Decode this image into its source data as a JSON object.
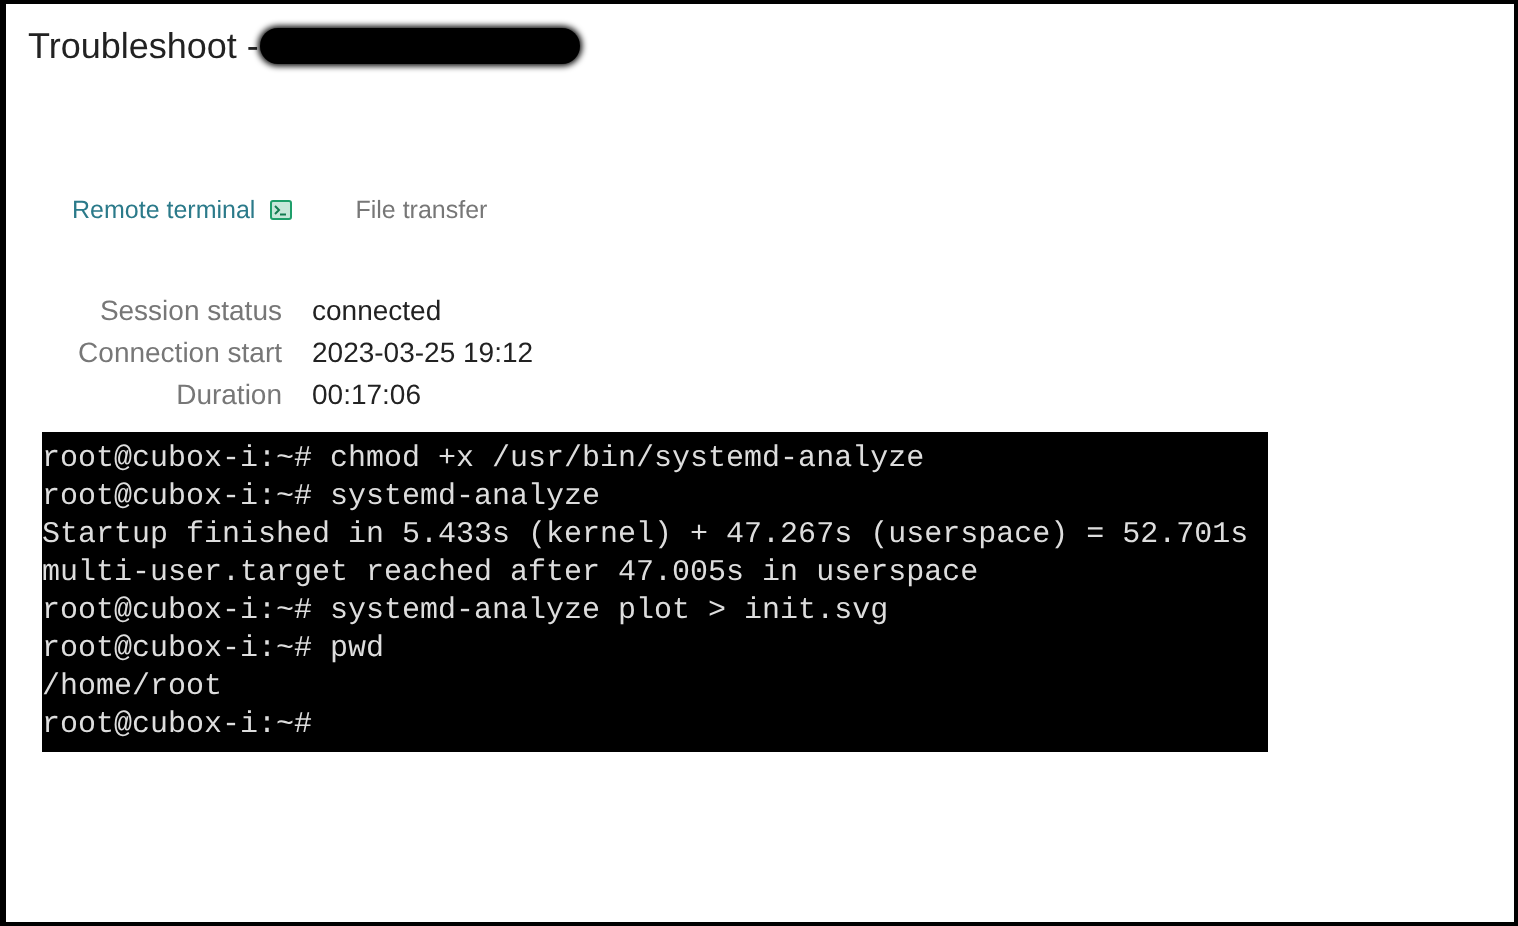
{
  "title": "Troubleshoot -",
  "tabs": [
    {
      "label": "Remote terminal",
      "selected": true,
      "icon": true
    },
    {
      "label": "File transfer",
      "selected": false,
      "icon": false
    }
  ],
  "session": [
    {
      "label": "Session status",
      "value": "connected"
    },
    {
      "label": "Connection start",
      "value": "2023-03-25 19:12"
    },
    {
      "label": "Duration",
      "value": "00:17:06"
    }
  ],
  "terminal_lines": [
    "root@cubox-i:~# chmod +x /usr/bin/systemd-analyze",
    "root@cubox-i:~# systemd-analyze",
    "Startup finished in 5.433s (kernel) + 47.267s (userspace) = 52.701s",
    "multi-user.target reached after 47.005s in userspace",
    "root@cubox-i:~# systemd-analyze plot > init.svg",
    "root@cubox-i:~# pwd",
    "/home/root",
    "root@cubox-i:~#"
  ]
}
